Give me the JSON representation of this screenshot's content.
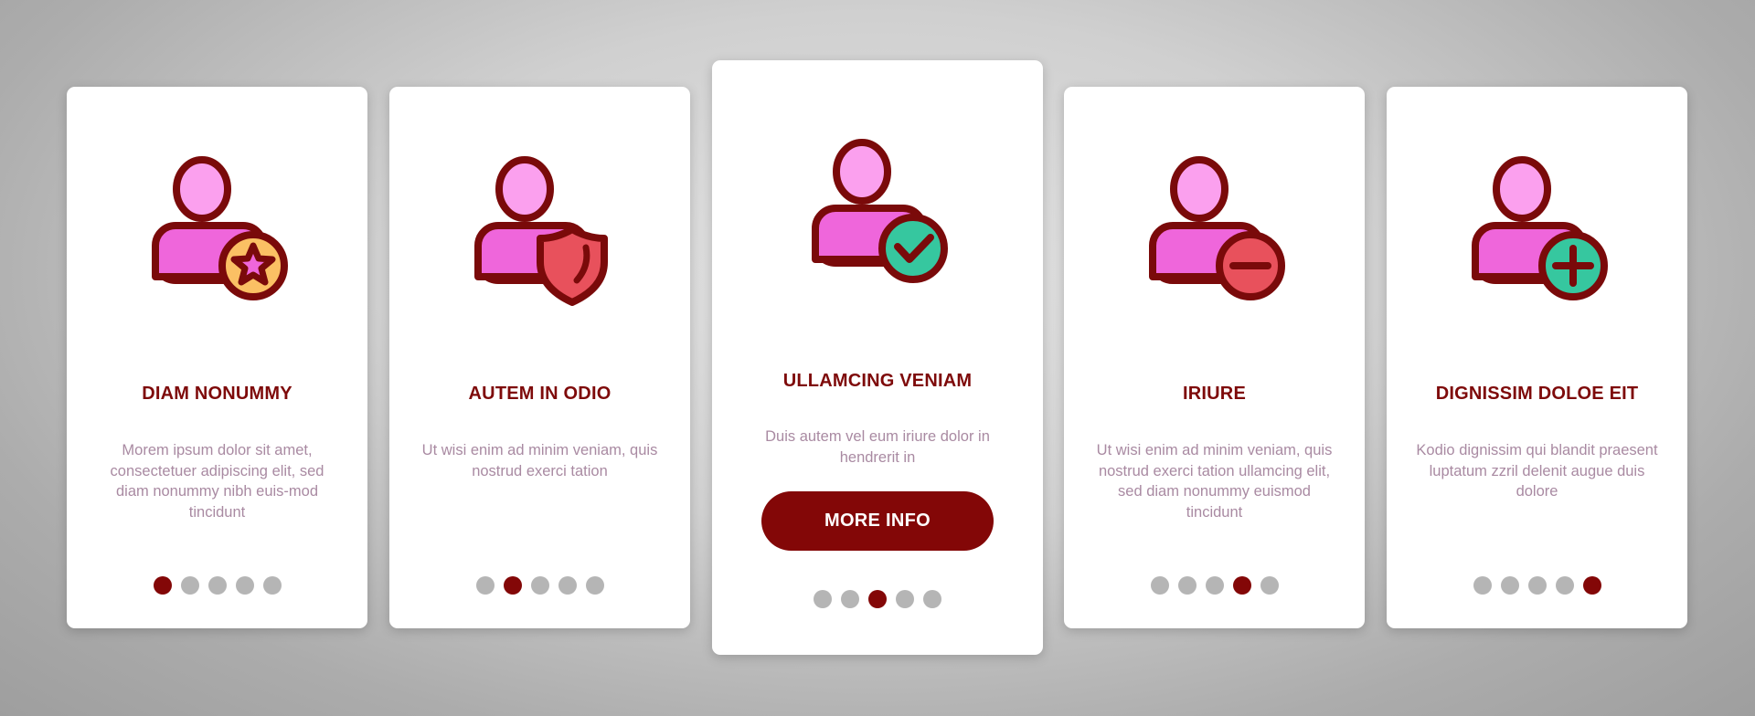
{
  "colors": {
    "accent": "#830707",
    "title": "#7e0a0a",
    "body_text": "#a98aa2",
    "dot_inactive": "#b5b5b5",
    "icon_outline": "#7a0a0a",
    "icon_head": "#fba0ee",
    "icon_body": "#ef66db",
    "badge_star": "#fbc064",
    "badge_shield": "#e8515c",
    "badge_check": "#36c79f",
    "badge_minus": "#e8515c",
    "badge_plus": "#36c79f"
  },
  "cards": [
    {
      "icon": "user-star-icon",
      "title": "DIAM NONUMMY",
      "body": "Morem ipsum dolor sit amet, consectetuer adipiscing elit, sed diam nonummy nibh euis-mod tincidunt",
      "active_page": 1,
      "total_pages": 5
    },
    {
      "icon": "user-shield-icon",
      "title": "AUTEM IN ODIO",
      "body": "Ut wisi enim ad minim veniam, quis nostrud exerci tation",
      "active_page": 2,
      "total_pages": 5
    },
    {
      "icon": "user-check-icon",
      "title": "ULLAMCING VENIAM",
      "body": "Duis autem vel eum iriure dolor in hendrerit in",
      "button_label": "MORE INFO",
      "active_page": 3,
      "total_pages": 5
    },
    {
      "icon": "user-minus-icon",
      "title": "IRIURE",
      "body": "Ut wisi enim ad minim veniam, quis nostrud exerci tation ullamcing elit, sed diam nonummy euismod tincidunt",
      "active_page": 4,
      "total_pages": 5
    },
    {
      "icon": "user-plus-icon",
      "title": "DIGNISSIM DOLOE EIT",
      "body": "Kodio dignissim qui blandit praesent luptatum zzril delenit augue duis dolore",
      "active_page": 5,
      "total_pages": 5
    }
  ]
}
